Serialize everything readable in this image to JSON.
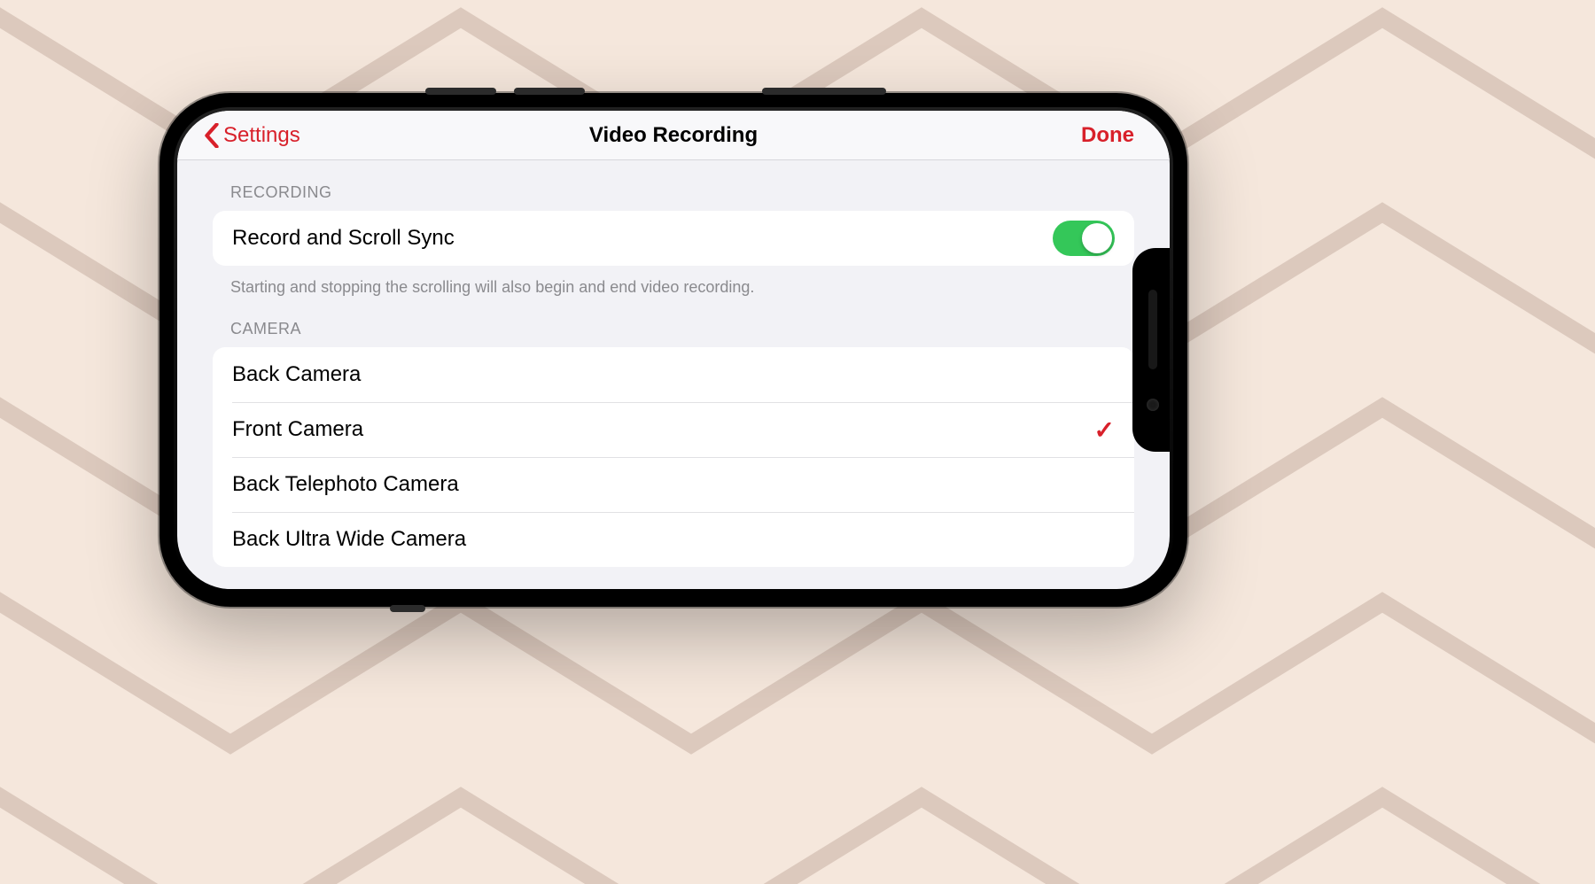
{
  "nav": {
    "back_label": "Settings",
    "title": "Video Recording",
    "done_label": "Done"
  },
  "sections": {
    "recording": {
      "header": "RECORDING",
      "toggle_label": "Record and Scroll Sync",
      "toggle_on": true,
      "footer": "Starting and stopping the scrolling will also begin and end video recording."
    },
    "camera": {
      "header": "CAMERA",
      "options": [
        {
          "label": "Back Camera",
          "selected": false
        },
        {
          "label": "Front Camera",
          "selected": true
        },
        {
          "label": "Back Telephoto Camera",
          "selected": false
        },
        {
          "label": "Back Ultra Wide Camera",
          "selected": false
        }
      ]
    }
  }
}
